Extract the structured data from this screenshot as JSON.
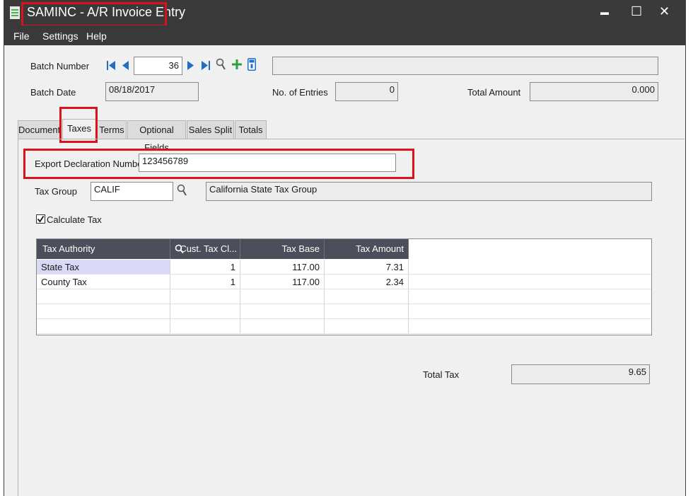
{
  "window": {
    "title": "SAMINC - A/R Invoice Entry",
    "controls": {
      "minimize": "▬",
      "maximize": "☐",
      "close": "✕"
    }
  },
  "menu": {
    "file": "File",
    "settings": "Settings",
    "help": "Help"
  },
  "header": {
    "batch_number_label": "Batch Number",
    "batch_number_value": "36",
    "batch_description": "",
    "batch_date_label": "Batch Date",
    "batch_date_value": "08/18/2017",
    "entries_label": "No. of Entries",
    "entries_value": "0",
    "total_amount_label": "Total Amount",
    "total_amount_value": "0.000"
  },
  "tabs": [
    {
      "label": "Document"
    },
    {
      "label": "Taxes",
      "active": true
    },
    {
      "label": "Terms"
    },
    {
      "label": "Optional Fields"
    },
    {
      "label": "Sales Split"
    },
    {
      "label": "Totals"
    }
  ],
  "taxes": {
    "export_decl_label": "Export Declaration Number",
    "export_decl_value": "123456789",
    "tax_group_label": "Tax Group",
    "tax_group_value": "CALIF",
    "tax_group_desc": "California State Tax Group",
    "calculate_tax_label": "Calculate Tax",
    "calculate_tax_checked": true,
    "total_tax_label": "Total Tax",
    "total_tax_value": "9.65"
  },
  "grid": {
    "columns": [
      "Tax Authority",
      "Cust. Tax Cl...",
      "Tax Base",
      "Tax Amount"
    ],
    "rows": [
      {
        "authority": "State Tax",
        "cls": "1",
        "base": "117.00",
        "amount": "7.31"
      },
      {
        "authority": "County Tax",
        "cls": "1",
        "base": "117.00",
        "amount": "2.34"
      }
    ]
  },
  "colors": {
    "titlebar": "#3a3a3a",
    "highlight": "#d9121b",
    "nav_blue": "#1f6fc5",
    "add_green": "#2e9e3e"
  }
}
